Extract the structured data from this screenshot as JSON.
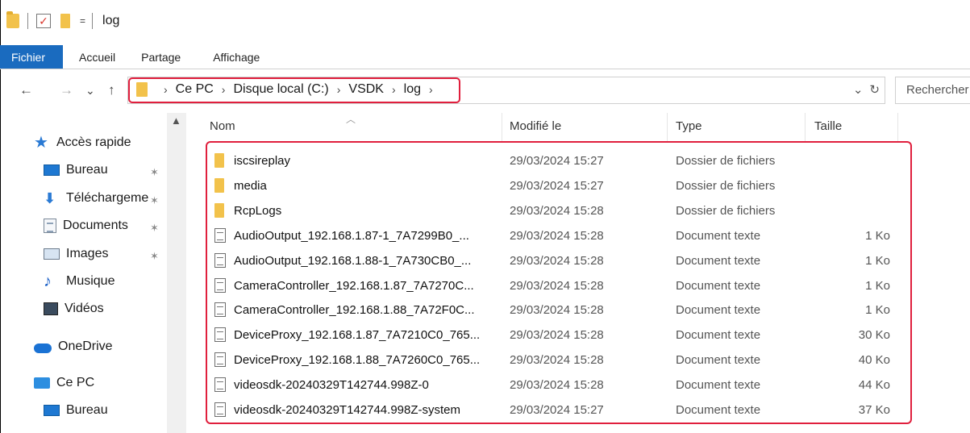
{
  "titlebar": {
    "title": "log",
    "dropdown": "="
  },
  "ribbon": {
    "tabs": [
      "Fichier",
      "Accueil",
      "Partage",
      "Affichage"
    ]
  },
  "nav_buttons": {
    "back": "←",
    "forward": "→",
    "recent": "⌄",
    "up": "↑"
  },
  "address": {
    "crumbs": [
      "Ce PC",
      "Disque local (C:)",
      "VSDK",
      "log"
    ],
    "chevron": "›",
    "dropdown": "⌄",
    "refresh": "↻",
    "search_placeholder": "Rechercher"
  },
  "sidebar": {
    "items": [
      {
        "label": "Accès rapide",
        "icon": "star-icon",
        "pinned": false
      },
      {
        "label": "Bureau",
        "icon": "desktop-icon",
        "pinned": true
      },
      {
        "label": "Téléchargeme",
        "icon": "download-icon",
        "pinned": true
      },
      {
        "label": "Documents",
        "icon": "documents-icon",
        "pinned": true
      },
      {
        "label": "Images",
        "icon": "images-icon",
        "pinned": true
      },
      {
        "label": "Musique",
        "icon": "music-icon",
        "pinned": false
      },
      {
        "label": "Vidéos",
        "icon": "videos-icon",
        "pinned": false
      },
      {
        "label": "OneDrive",
        "icon": "onedrive-icon",
        "pinned": false
      },
      {
        "label": "Ce PC",
        "icon": "pc-icon",
        "pinned": false
      },
      {
        "label": "Bureau",
        "icon": "desktop-icon",
        "pinned": false
      }
    ]
  },
  "columns": {
    "name": "Nom",
    "modified": "Modifié le",
    "type": "Type",
    "size": "Taille"
  },
  "files": [
    {
      "name": "iscsireplay",
      "modified": "29/03/2024 15:27",
      "type": "Dossier de fichiers",
      "size": "",
      "kind": "folder"
    },
    {
      "name": "media",
      "modified": "29/03/2024 15:27",
      "type": "Dossier de fichiers",
      "size": "",
      "kind": "folder"
    },
    {
      "name": "RcpLogs",
      "modified": "29/03/2024 15:28",
      "type": "Dossier de fichiers",
      "size": "",
      "kind": "folder"
    },
    {
      "name": "AudioOutput_192.168.1.87-1_7A7299B0_...",
      "modified": "29/03/2024 15:28",
      "type": "Document texte",
      "size": "1 Ko",
      "kind": "text"
    },
    {
      "name": "AudioOutput_192.168.1.88-1_7A730CB0_...",
      "modified": "29/03/2024 15:28",
      "type": "Document texte",
      "size": "1 Ko",
      "kind": "text"
    },
    {
      "name": "CameraController_192.168.1.87_7A7270C...",
      "modified": "29/03/2024 15:28",
      "type": "Document texte",
      "size": "1 Ko",
      "kind": "text"
    },
    {
      "name": "CameraController_192.168.1.88_7A72F0C...",
      "modified": "29/03/2024 15:28",
      "type": "Document texte",
      "size": "1 Ko",
      "kind": "text"
    },
    {
      "name": "DeviceProxy_192.168.1.87_7A7210C0_765...",
      "modified": "29/03/2024 15:28",
      "type": "Document texte",
      "size": "30 Ko",
      "kind": "text"
    },
    {
      "name": "DeviceProxy_192.168.1.88_7A7260C0_765...",
      "modified": "29/03/2024 15:28",
      "type": "Document texte",
      "size": "40 Ko",
      "kind": "text"
    },
    {
      "name": "videosdk-20240329T142744.998Z-0",
      "modified": "29/03/2024 15:28",
      "type": "Document texte",
      "size": "44 Ko",
      "kind": "text"
    },
    {
      "name": "videosdk-20240329T142744.998Z-system",
      "modified": "29/03/2024 15:27",
      "type": "Document texte",
      "size": "37 Ko",
      "kind": "text"
    }
  ],
  "colors": {
    "accent": "#1a6bbf",
    "highlight": "#e01f3d",
    "folder": "#f2c24b"
  }
}
